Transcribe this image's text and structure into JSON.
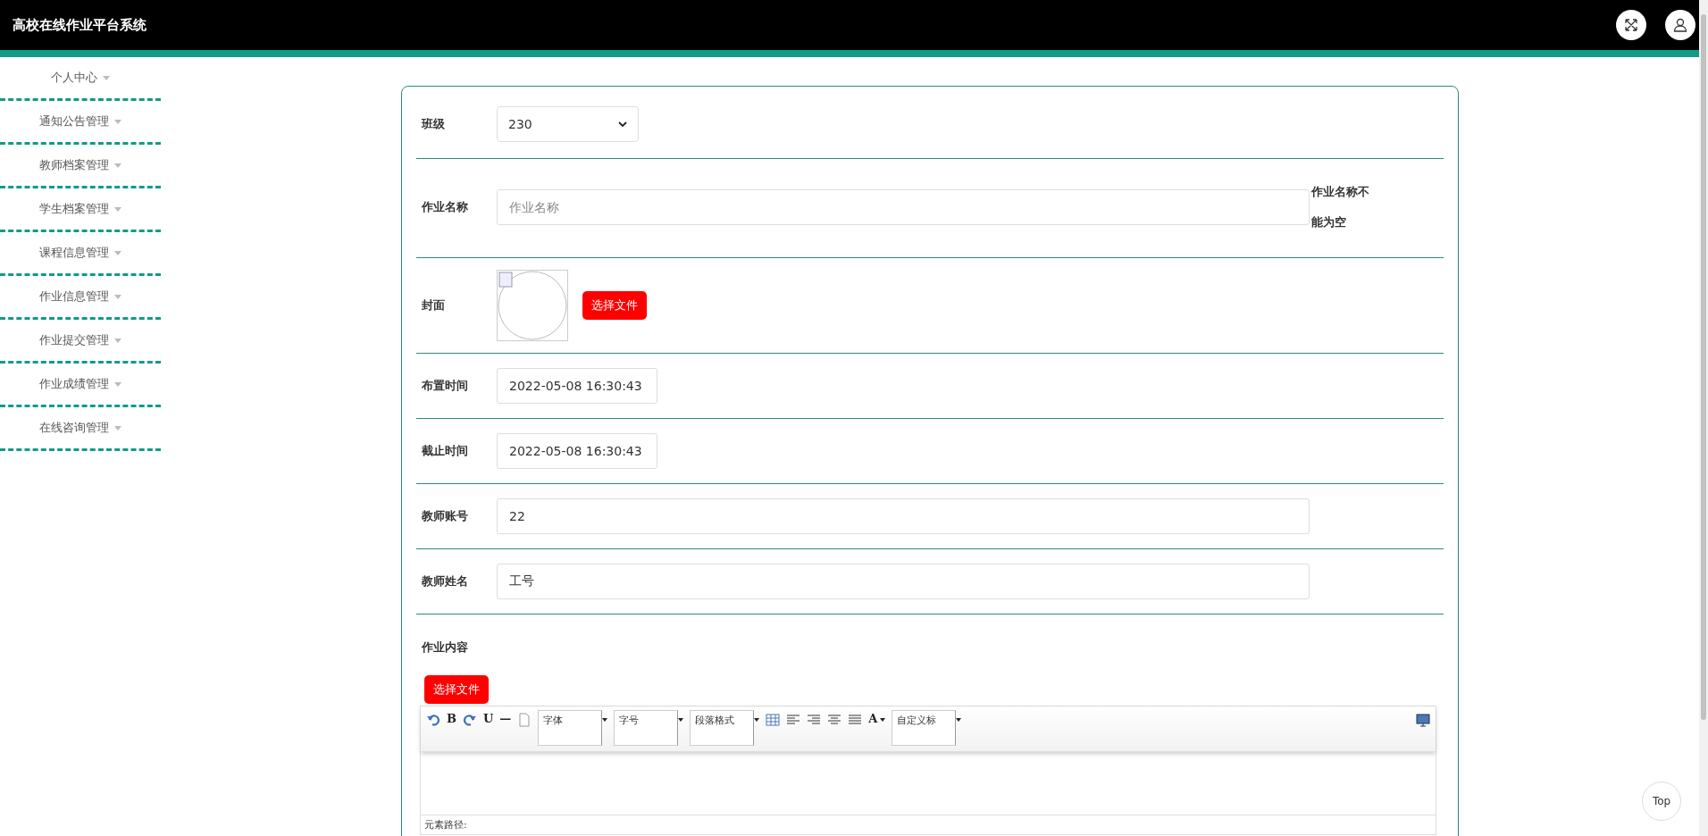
{
  "header": {
    "title": "高校在线作业平台系统"
  },
  "sidebar": {
    "items": [
      {
        "label": "个人中心"
      },
      {
        "label": "通知公告管理"
      },
      {
        "label": "教师档案管理"
      },
      {
        "label": "学生档案管理"
      },
      {
        "label": "课程信息管理"
      },
      {
        "label": "作业信息管理"
      },
      {
        "label": "作业提交管理"
      },
      {
        "label": "作业成绩管理"
      },
      {
        "label": "在线咨询管理"
      }
    ]
  },
  "form": {
    "rows": [
      {
        "kind": "select",
        "label": "班级",
        "value": "230"
      },
      {
        "kind": "text",
        "label": "作业名称",
        "placeholder": "作业名称",
        "error": "作业名称不能为空"
      },
      {
        "kind": "image",
        "label": "封面",
        "button": "选择文件"
      },
      {
        "kind": "date",
        "label": "布置时间",
        "value": "2022-05-08 16:30:43"
      },
      {
        "kind": "date",
        "label": "截止时间",
        "value": "2022-05-08 16:30:43"
      },
      {
        "kind": "text",
        "label": "教师账号",
        "value": "22"
      },
      {
        "kind": "text",
        "label": "教师姓名",
        "value": "工号"
      },
      {
        "kind": "editor",
        "label": "作业内容",
        "button": "选择文件"
      }
    ]
  },
  "editor": {
    "toolbar": [
      {
        "kind": "undo"
      },
      {
        "kind": "char",
        "text": "B"
      },
      {
        "kind": "redo"
      },
      {
        "kind": "char",
        "text": "U"
      },
      {
        "kind": "char",
        "text": "—"
      },
      {
        "kind": "page"
      },
      {
        "kind": "dropdown",
        "text": "字体"
      },
      {
        "kind": "dropdown",
        "text": "字号"
      },
      {
        "kind": "dropdown",
        "text": "段落格式"
      },
      {
        "kind": "table"
      },
      {
        "kind": "align-left"
      },
      {
        "kind": "align-right"
      },
      {
        "kind": "align-center"
      },
      {
        "kind": "justify"
      },
      {
        "kind": "color",
        "text": "A"
      },
      {
        "kind": "dropdown",
        "text": "自定义标"
      },
      {
        "kind": "preview"
      }
    ],
    "path_label": "元素路径:"
  },
  "top_button": "Top"
}
